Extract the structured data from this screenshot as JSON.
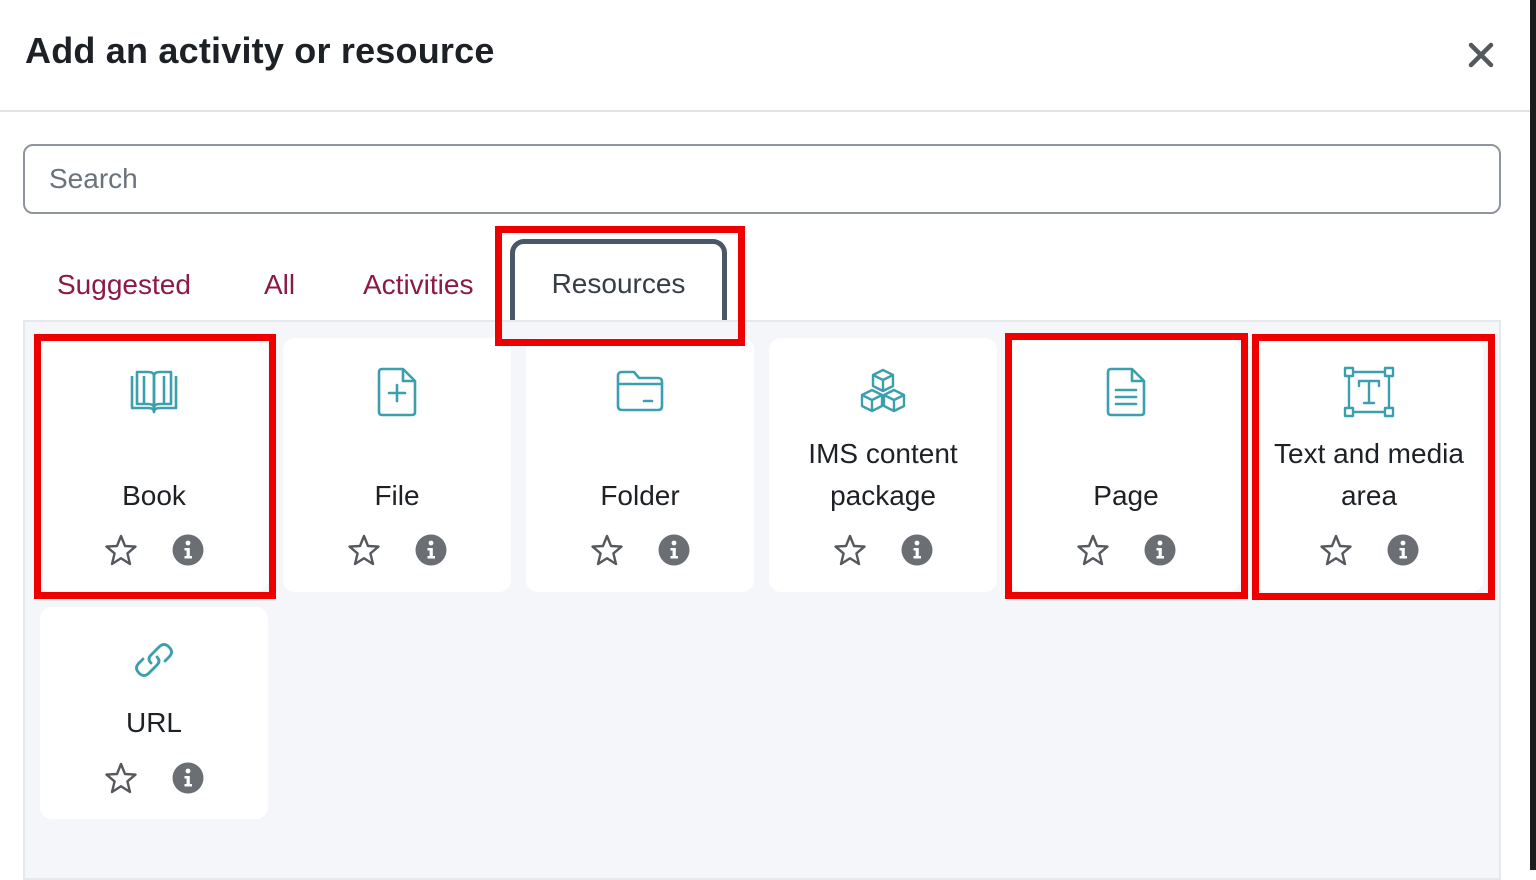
{
  "modal": {
    "title": "Add an activity or resource",
    "close_icon": "close-icon"
  },
  "search": {
    "placeholder": "Search",
    "value": ""
  },
  "tabs": [
    {
      "label": "Suggested",
      "active": false
    },
    {
      "label": "All",
      "active": false
    },
    {
      "label": "Activities",
      "active": false
    },
    {
      "label": "Resources",
      "active": true
    }
  ],
  "items": [
    {
      "label_line1": "",
      "label_line2": "Book",
      "icon": "book-icon",
      "highlighted": true
    },
    {
      "label_line1": "",
      "label_line2": "File",
      "icon": "file-plus-icon",
      "highlighted": false
    },
    {
      "label_line1": "",
      "label_line2": "Folder",
      "icon": "folder-icon",
      "highlighted": false
    },
    {
      "label_line1": "IMS content",
      "label_line2": "package",
      "icon": "cubes-icon",
      "highlighted": false
    },
    {
      "label_line1": "",
      "label_line2": "Page",
      "icon": "page-icon",
      "highlighted": true
    },
    {
      "label_line1": "Text and media",
      "label_line2": "area",
      "icon": "text-area-icon",
      "highlighted": true
    },
    {
      "label_line1": "",
      "label_line2": "URL",
      "icon": "link-icon",
      "highlighted": false
    }
  ],
  "colors": {
    "icon_teal": "#3b9fae",
    "tab_link": "#8b1a47",
    "highlight_red": "#ee0000",
    "active_tab_border": "#4a5768",
    "info_grey": "#6b6f74"
  }
}
